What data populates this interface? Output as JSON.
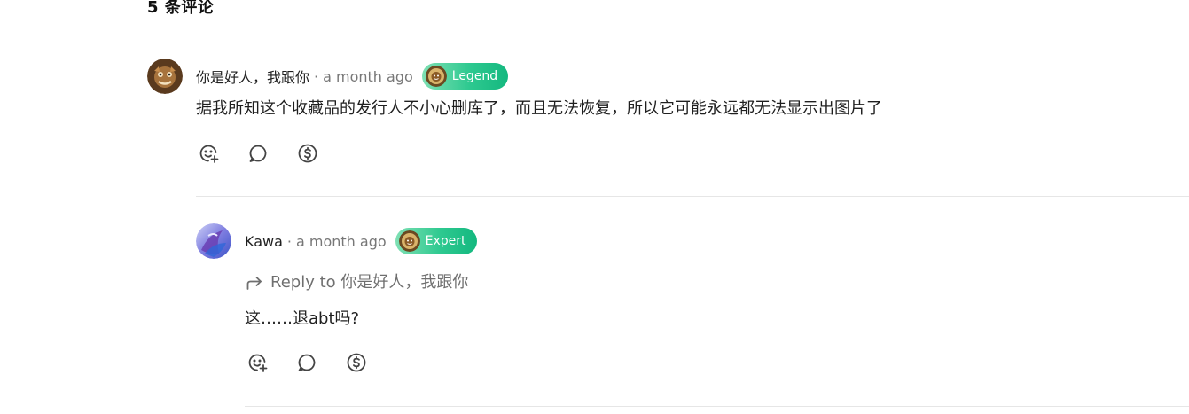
{
  "comments_header": {
    "title": "5 条评论"
  },
  "comments": [
    {
      "author": "你是好人，我跟你",
      "separator": "·",
      "time": "a month ago",
      "badge": {
        "label": "Legend",
        "icon": "lion-medallion-icon"
      },
      "body": "据我所知这个收藏品的发行人不小心删库了，而且无法恢复，所以它可能永远都无法显示出图片了",
      "actions": [
        "add-reaction-icon",
        "reply-comment-icon",
        "tip-dollar-icon"
      ]
    },
    {
      "author": "Kawa",
      "separator": "·",
      "time": "a month ago",
      "badge": {
        "label": "Expert",
        "icon": "lion-medallion-icon"
      },
      "reply_to": "Reply to 你是好人，我跟你",
      "body": "这……退abt吗?",
      "actions": [
        "add-reaction-icon",
        "reply-comment-icon",
        "tip-dollar-icon"
      ]
    }
  ],
  "colors": {
    "badge_gradient_start": "#7fe0b4",
    "badge_gradient_end": "#14b87f",
    "muted_text": "#777777",
    "divider": "#e6e6e6"
  }
}
